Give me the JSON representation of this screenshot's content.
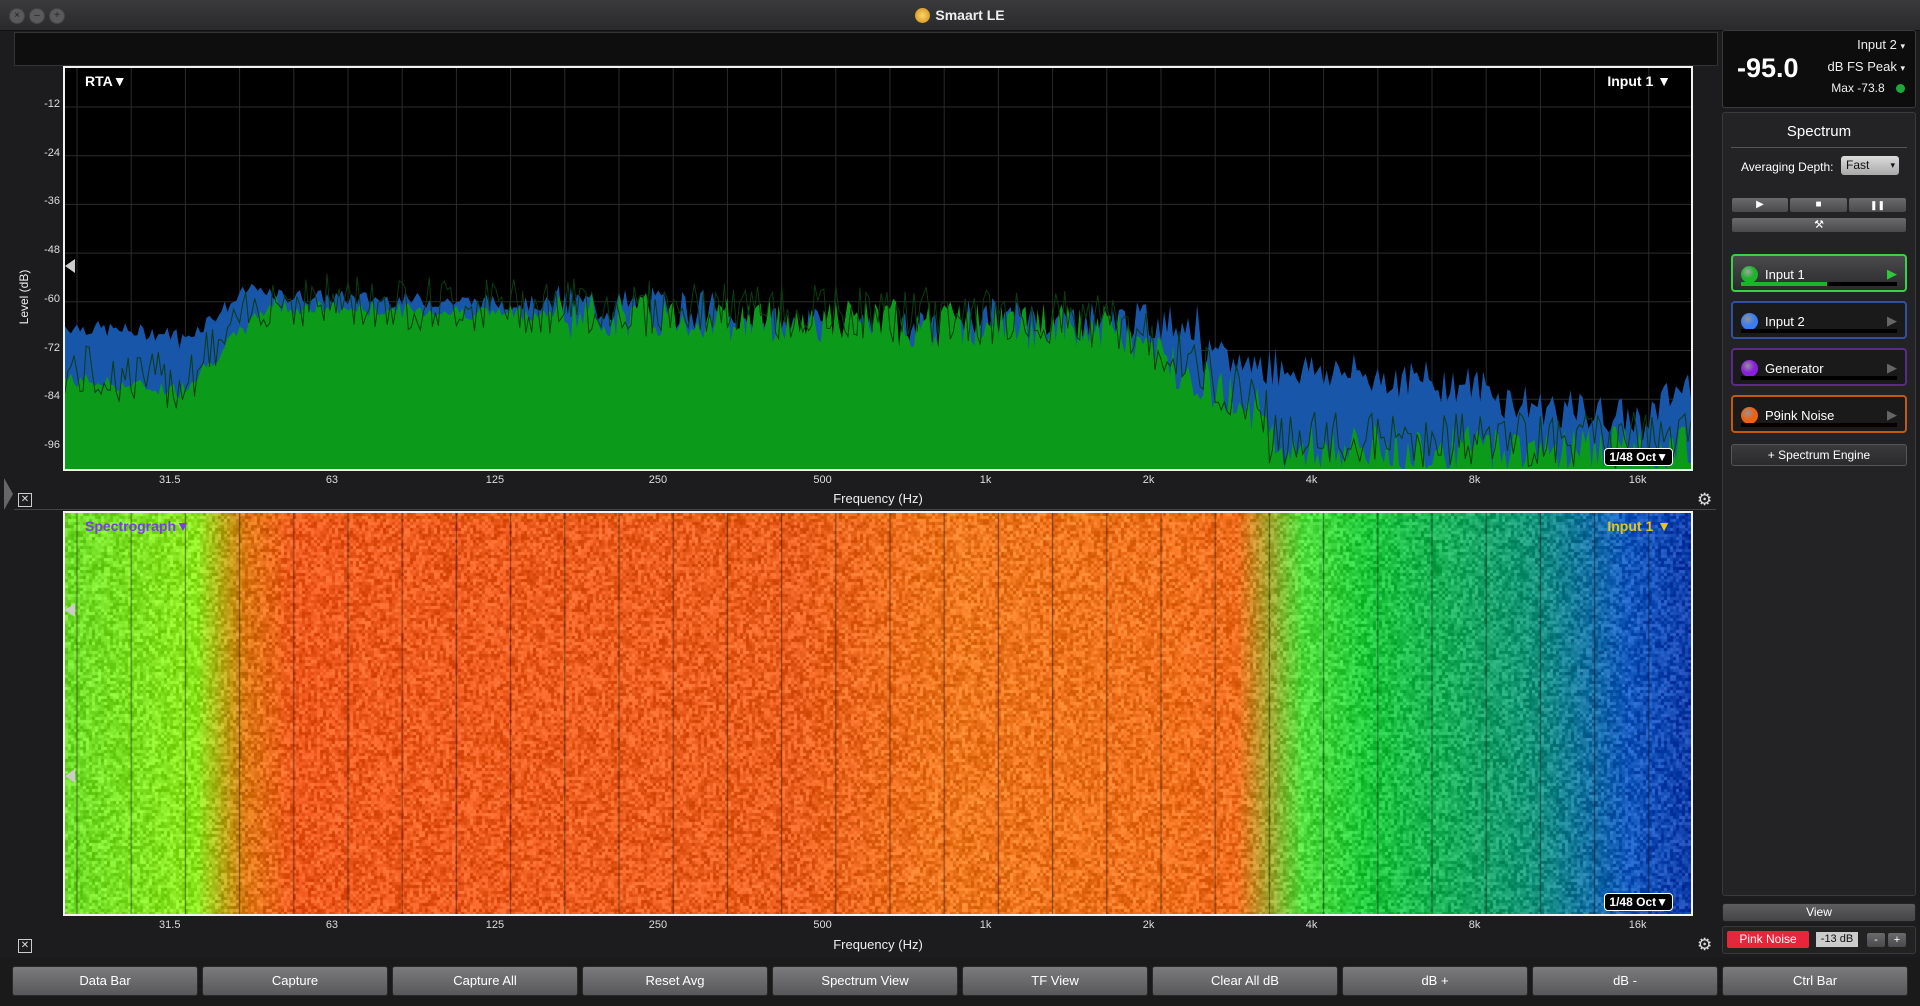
{
  "window": {
    "title": "Smaart LE"
  },
  "rta": {
    "mode_label": "RTA▼",
    "input_label": "Input 1 ▼",
    "resolution": "1/48 Oct▼",
    "y_axis_title": "Level (dB)",
    "y_ticks": [
      "-12",
      "-24",
      "-36",
      "-48",
      "-60",
      "-72",
      "-84",
      "-96"
    ],
    "x_ticks": [
      "31.5",
      "63",
      "125",
      "250",
      "500",
      "1k",
      "2k",
      "4k",
      "8k",
      "16k"
    ],
    "x_axis_title": "Frequency (Hz)",
    "colors": {
      "input2_fill": "#1756a8",
      "input1_fill": "#0c9a1a",
      "trace": "#0a3d10"
    }
  },
  "spectrograph": {
    "mode_label": "Spectrograph▼",
    "input_label": "Input 1 ▼",
    "resolution": "1/48 Oct▼",
    "x_ticks": [
      "31.5",
      "63",
      "125",
      "250",
      "500",
      "1k",
      "2k",
      "4k",
      "8k",
      "16k"
    ],
    "x_axis_title": "Frequency (Hz)"
  },
  "meter": {
    "value": "-95.0",
    "input_select": "Input 2",
    "units_select": "dB FS Peak",
    "max_label": "Max -73.8",
    "status_color": "#1fa83a"
  },
  "spectrum_panel": {
    "title": "Spectrum",
    "averaging_label": "Averaging Depth:",
    "averaging_value": "Fast",
    "transport": {
      "play": "▶",
      "stop": "■",
      "pause": "❚❚",
      "tools": "⚒"
    },
    "sources": [
      {
        "name": "Input 1",
        "color": "#1db32a",
        "border": "#3ad04a",
        "level": 0.55
      },
      {
        "name": "Input 2",
        "color": "#3a7df0",
        "border": "#3350a0",
        "level": 0
      },
      {
        "name": "Generator",
        "color": "#8a1ee0",
        "border": "#5a2a8a",
        "level": 0
      },
      {
        "name": "P9ink Noise",
        "color": "#f06010",
        "border": "#c05a10",
        "level": 0
      }
    ],
    "add_engine": "+ Spectrum Engine",
    "view_button": "View"
  },
  "generator": {
    "pink_noise": "Pink Noise",
    "level": "-13 dB",
    "minus": "-",
    "plus": "+"
  },
  "bottom_bar": [
    "Data Bar",
    "Capture",
    "Capture All",
    "Reset Avg",
    "Spectrum View",
    "TF View",
    "Clear All dB",
    "dB +",
    "dB -",
    "Ctrl Bar"
  ]
}
